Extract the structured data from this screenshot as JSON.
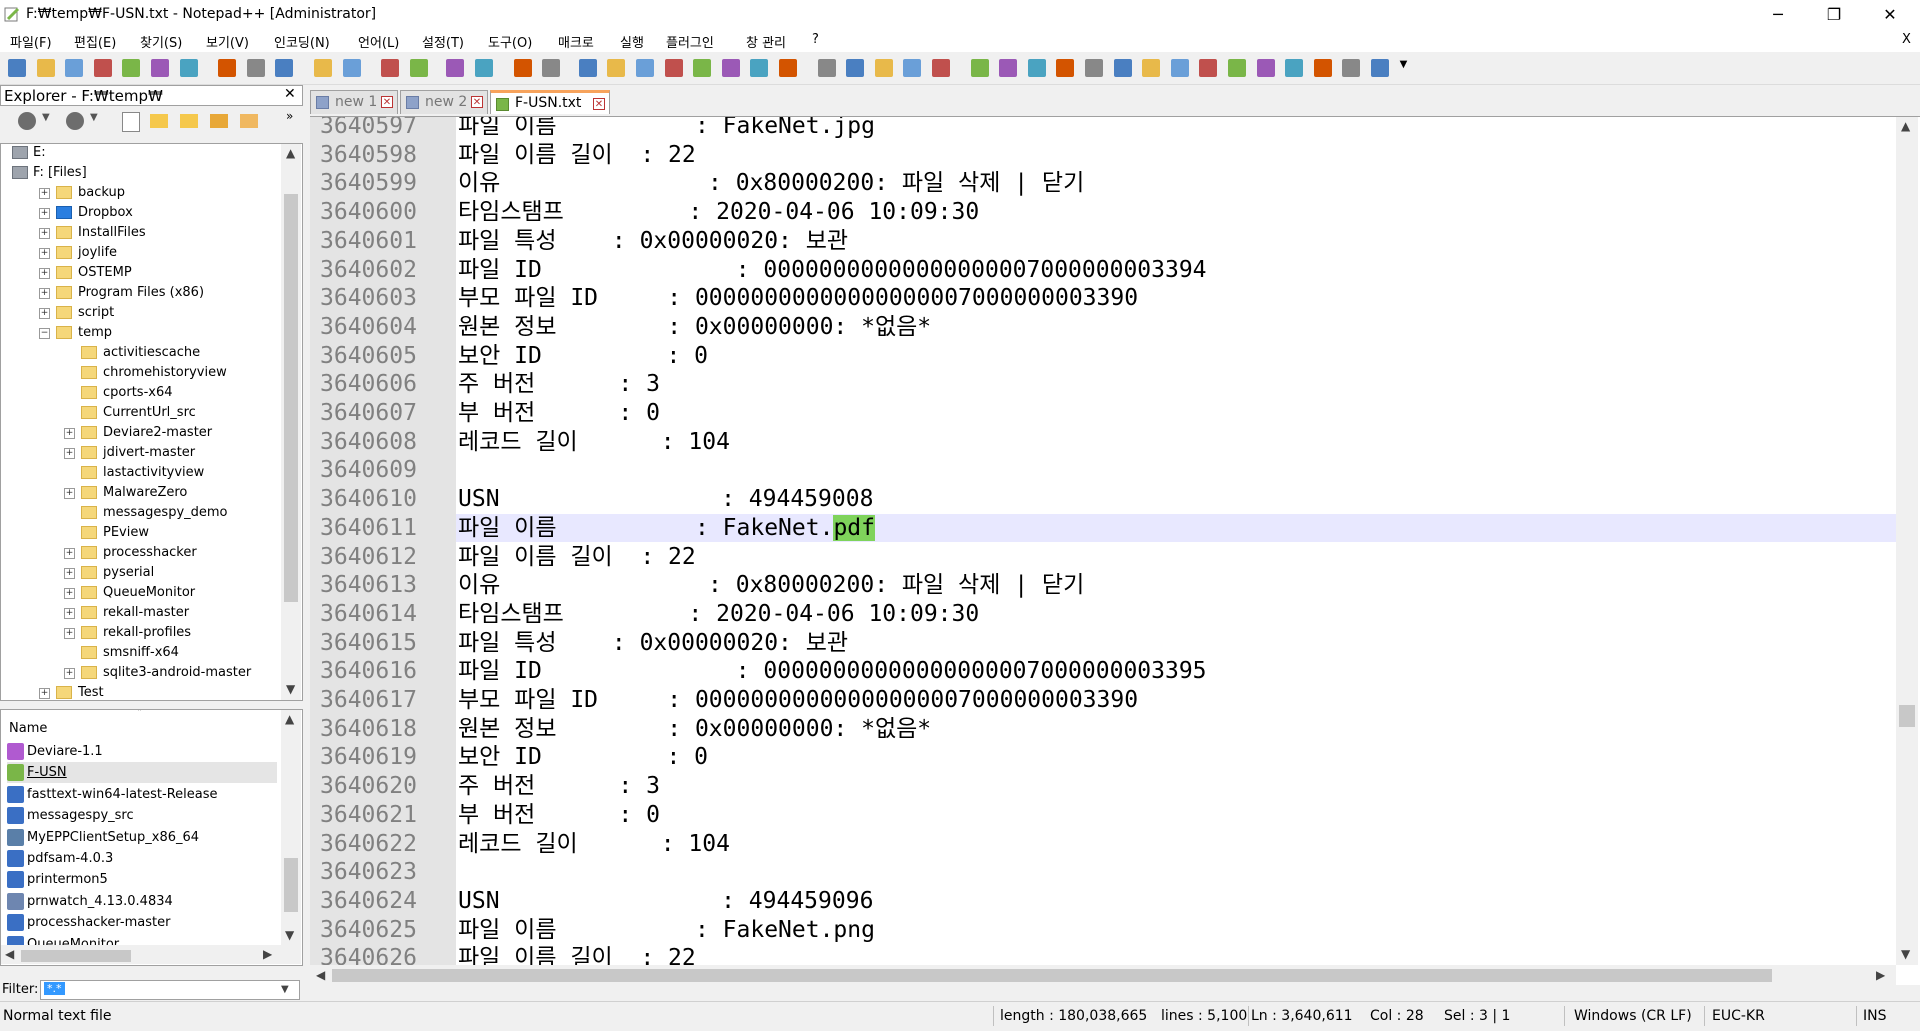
{
  "window": {
    "title": "F:₩temp₩F-USN.txt - Notepad++ [Administrator]",
    "minimize": "─",
    "maximize": "❐",
    "close": "✕"
  },
  "menu": {
    "items": [
      "파일(F)",
      "편집(E)",
      "찾기(S)",
      "보기(V)",
      "인코딩(N)",
      "언어(L)",
      "설정(T)",
      "도구(O)",
      "매크로",
      "실행",
      "플러그인",
      "창 관리",
      "?"
    ],
    "doc_close": "X"
  },
  "explorer": {
    "title": "Explorer - F:₩temp₩",
    "close": "✕",
    "tree": [
      {
        "label": "E:",
        "indent": 0,
        "type": "drive",
        "expander": ""
      },
      {
        "label": "F: [Files]",
        "indent": 0,
        "type": "drive",
        "expander": ""
      },
      {
        "label": "backup",
        "indent": 1,
        "type": "folder",
        "expander": "+"
      },
      {
        "label": "Dropbox",
        "indent": 1,
        "type": "dropbox",
        "expander": "+"
      },
      {
        "label": "InstallFiles",
        "indent": 1,
        "type": "folder",
        "expander": "+"
      },
      {
        "label": "joylife",
        "indent": 1,
        "type": "folder",
        "expander": "+"
      },
      {
        "label": "OSTEMP",
        "indent": 1,
        "type": "folder",
        "expander": "+"
      },
      {
        "label": "Program Files (x86)",
        "indent": 1,
        "type": "folder",
        "expander": "+"
      },
      {
        "label": "script",
        "indent": 1,
        "type": "folder",
        "expander": "+"
      },
      {
        "label": "temp",
        "indent": 1,
        "type": "folder",
        "expander": "−"
      },
      {
        "label": "activitiescache",
        "indent": 2,
        "type": "folder",
        "expander": ""
      },
      {
        "label": "chromehistoryview",
        "indent": 2,
        "type": "folder",
        "expander": ""
      },
      {
        "label": "cports-x64",
        "indent": 2,
        "type": "folder",
        "expander": ""
      },
      {
        "label": "CurrentUrl_src",
        "indent": 2,
        "type": "folder",
        "expander": ""
      },
      {
        "label": "Deviare2-master",
        "indent": 2,
        "type": "folder",
        "expander": "+"
      },
      {
        "label": "jdivert-master",
        "indent": 2,
        "type": "folder",
        "expander": "+"
      },
      {
        "label": "lastactivityview",
        "indent": 2,
        "type": "folder",
        "expander": ""
      },
      {
        "label": "MalwareZero",
        "indent": 2,
        "type": "folder",
        "expander": "+"
      },
      {
        "label": "messagespy_demo",
        "indent": 2,
        "type": "folder",
        "expander": ""
      },
      {
        "label": "PEview",
        "indent": 2,
        "type": "folder",
        "expander": ""
      },
      {
        "label": "processhacker",
        "indent": 2,
        "type": "folder",
        "expander": "+"
      },
      {
        "label": "pyserial",
        "indent": 2,
        "type": "folder",
        "expander": "+"
      },
      {
        "label": "QueueMonitor",
        "indent": 2,
        "type": "folder",
        "expander": "+"
      },
      {
        "label": "rekall-master",
        "indent": 2,
        "type": "folder",
        "expander": "+"
      },
      {
        "label": "rekall-profiles",
        "indent": 2,
        "type": "folder",
        "expander": "+"
      },
      {
        "label": "smsniff-x64",
        "indent": 2,
        "type": "folder",
        "expander": ""
      },
      {
        "label": "sqlite3-android-master",
        "indent": 2,
        "type": "folder",
        "expander": "+"
      },
      {
        "label": "Test",
        "indent": 1,
        "type": "folder",
        "expander": "+"
      }
    ],
    "files_header": "Name",
    "files": [
      {
        "name": "Deviare-1.1",
        "icon": "#b05ad0"
      },
      {
        "name": "F-USN",
        "icon": "#7ab648"
      },
      {
        "name": "fasttext-win64-latest-Release",
        "icon": "#3a6fc4"
      },
      {
        "name": "messagespy_src",
        "icon": "#3a6fc4"
      },
      {
        "name": "MyEPPClientSetup_x86_64",
        "icon": "#5a7fa8"
      },
      {
        "name": "pdfsam-4.0.3",
        "icon": "#3a6fc4"
      },
      {
        "name": "printermon5",
        "icon": "#3a6fc4"
      },
      {
        "name": "prnwatch_4.13.0.4834",
        "icon": "#6e86b0"
      },
      {
        "name": "processhacker-master",
        "icon": "#3a6fc4"
      },
      {
        "name": "QueueMonitor",
        "icon": "#3a6fc4"
      }
    ],
    "filter_label": "Filter:",
    "filter_value": "*.*"
  },
  "tabs": [
    {
      "label": "new 1",
      "active": false
    },
    {
      "label": "new 2",
      "active": false
    },
    {
      "label": "F-USN.txt",
      "active": true
    }
  ],
  "editor": {
    "current_line": "3640611",
    "highlight": "pdf",
    "lines": [
      {
        "n": "3640597",
        "t": "파일 이름          : FakeNet.jpg"
      },
      {
        "n": "3640598",
        "t": "파일 이름 길이  : 22"
      },
      {
        "n": "3640599",
        "t": "이유               : 0x80000200: 파일 삭제 | 닫기"
      },
      {
        "n": "3640600",
        "t": "타임스탬프         : 2020-04-06 10:09:30"
      },
      {
        "n": "3640601",
        "t": "파일 특성    : 0x00000020: 보관"
      },
      {
        "n": "3640602",
        "t": "파일 ID              : 00000000000000000007000000003394"
      },
      {
        "n": "3640603",
        "t": "부모 파일 ID     : 00000000000000000007000000003390"
      },
      {
        "n": "3640604",
        "t": "원본 정보        : 0x00000000: *없음*"
      },
      {
        "n": "3640605",
        "t": "보안 ID         : 0"
      },
      {
        "n": "3640606",
        "t": "주 버전      : 3"
      },
      {
        "n": "3640607",
        "t": "부 버전      : 0"
      },
      {
        "n": "3640608",
        "t": "레코드 길이      : 104"
      },
      {
        "n": "3640609",
        "t": ""
      },
      {
        "n": "3640610",
        "t": "USN                : 494459008"
      },
      {
        "n": "3640611",
        "t": "파일 이름          : FakeNet.",
        "tail": "pdf"
      },
      {
        "n": "3640612",
        "t": "파일 이름 길이  : 22"
      },
      {
        "n": "3640613",
        "t": "이유               : 0x80000200: 파일 삭제 | 닫기"
      },
      {
        "n": "3640614",
        "t": "타임스탬프         : 2020-04-06 10:09:30"
      },
      {
        "n": "3640615",
        "t": "파일 특성    : 0x00000020: 보관"
      },
      {
        "n": "3640616",
        "t": "파일 ID              : 00000000000000000007000000003395"
      },
      {
        "n": "3640617",
        "t": "부모 파일 ID     : 00000000000000000007000000003390"
      },
      {
        "n": "3640618",
        "t": "원본 정보        : 0x00000000: *없음*"
      },
      {
        "n": "3640619",
        "t": "보안 ID         : 0"
      },
      {
        "n": "3640620",
        "t": "주 버전      : 3"
      },
      {
        "n": "3640621",
        "t": "부 버전      : 0"
      },
      {
        "n": "3640622",
        "t": "레코드 길이      : 104"
      },
      {
        "n": "3640623",
        "t": ""
      },
      {
        "n": "3640624",
        "t": "USN                : 494459096"
      },
      {
        "n": "3640625",
        "t": "파일 이름          : FakeNet.png"
      },
      {
        "n": "3640626",
        "t": "파일 이름 길이  : 22"
      }
    ]
  },
  "status": {
    "file_type": "Normal text file",
    "length": "length : 180,038,665",
    "lines": "lines : 5,100",
    "ln": "Ln : 3,640,611",
    "col": "Col : 28",
    "sel": "Sel : 3 | 1",
    "eol": "Windows (CR LF)",
    "encoding": "EUC-KR",
    "mode": "INS"
  },
  "toolbar_icons": [
    "new-file-icon",
    "open-file-icon",
    "save-icon",
    "save-all-icon",
    "close-icon",
    "close-all-icon",
    "print-icon",
    "cut-icon",
    "copy-icon",
    "paste-icon",
    "undo-icon",
    "redo-icon",
    "find-icon",
    "replace-icon",
    "zoom-in-icon",
    "zoom-out-icon",
    "sync-v-icon",
    "sync-h-icon",
    "wrap-icon",
    "show-all-icon",
    "indent-guide-icon",
    "udl-icon",
    "doc-map-icon",
    "function-list-icon",
    "folder-workspace-icon",
    "monitor-icon",
    "record-macro-icon",
    "stop-macro-icon",
    "play-macro-icon",
    "run-macro-multiple-icon",
    "save-macro-icon",
    "plugin-a-icon",
    "plugin-b-icon",
    "plugin-c-icon",
    "plugin-d-icon",
    "up-icon",
    "down-icon",
    "plugin-e-icon",
    "plugin-f-icon",
    "plugin-g-icon",
    "spellcheck-icon",
    "plugin-h-icon",
    "heart-icon",
    "italic-h-icon",
    "json-icon",
    "plugin-i-icon",
    "overflow-icon"
  ]
}
